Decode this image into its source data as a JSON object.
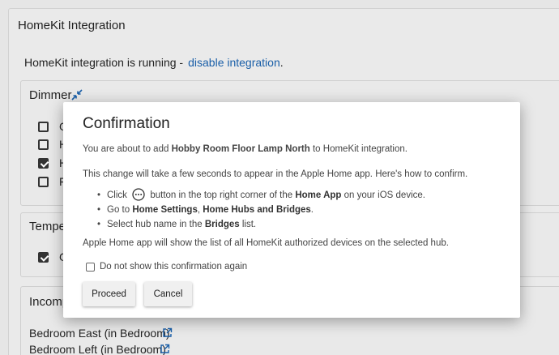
{
  "page": {
    "title": "HomeKit Integration",
    "status_text": "HomeKit integration is running -",
    "disable_link": "disable integration",
    "status_suffix": "."
  },
  "sections": {
    "dimmer": {
      "title": "Dimmer",
      "items": [
        {
          "label_fragment": "G",
          "checked": false
        },
        {
          "label_fragment": "H",
          "checked": false
        },
        {
          "label_fragment": "H",
          "checked": true
        },
        {
          "label_fragment": "F",
          "checked": false
        }
      ]
    },
    "temperature": {
      "title": "Tempe",
      "items": [
        {
          "label_fragment": "G",
          "checked": true
        }
      ]
    },
    "incompatible": {
      "title": "Incomp",
      "devices": [
        "Bedroom East (in Bedroom)",
        "Bedroom Left (in Bedroom)"
      ]
    }
  },
  "dialog": {
    "title": "Confirmation",
    "p1_pre": "You are about to add ",
    "p1_device": "Hobby Room Floor Lamp North",
    "p1_post": " to HomeKit integration.",
    "p2": "This change will take a few seconds to appear in the Apple Home app. Here's how to confirm.",
    "steps": {
      "s1_a": "Click",
      "s1_b": "button in the top right corner of the ",
      "s1_app": "Home App",
      "s1_c": " on your iOS device.",
      "s2_a": "Go to ",
      "s2_settings": "Home Settings",
      "s2_sep": ", ",
      "s2_hubs": "Home Hubs and Bridges",
      "s2_end": ".",
      "s3_a": "Select hub name in the ",
      "s3_bridges": "Bridges",
      "s3_end": " list."
    },
    "p3": "Apple Home app will show the list of all HomeKit authorized devices on the selected hub.",
    "checkbox_label": "Do not show this confirmation again",
    "proceed_label": "Proceed",
    "cancel_label": "Cancel"
  }
}
